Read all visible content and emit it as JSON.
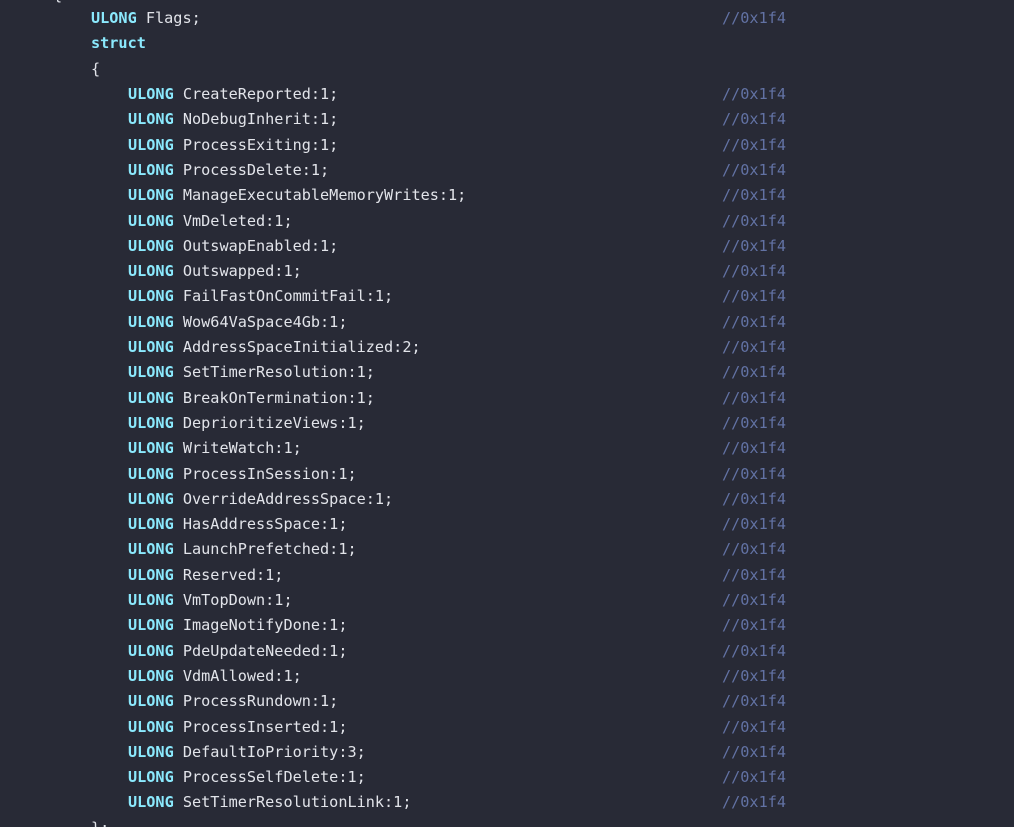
{
  "editor": {
    "top_partial": "{",
    "flags_line": {
      "type": "ULONG",
      "name": "Flags;",
      "comment": "//0x1f4"
    },
    "struct_keyword": "struct",
    "open_brace": "{",
    "close_partial": "};",
    "fields": [
      {
        "type": "ULONG",
        "name": "CreateReported:1;",
        "comment": "//0x1f4"
      },
      {
        "type": "ULONG",
        "name": "NoDebugInherit:1;",
        "comment": "//0x1f4"
      },
      {
        "type": "ULONG",
        "name": "ProcessExiting:1;",
        "comment": "//0x1f4"
      },
      {
        "type": "ULONG",
        "name": "ProcessDelete:1;",
        "comment": "//0x1f4"
      },
      {
        "type": "ULONG",
        "name": "ManageExecutableMemoryWrites:1;",
        "comment": "//0x1f4"
      },
      {
        "type": "ULONG",
        "name": "VmDeleted:1;",
        "comment": "//0x1f4"
      },
      {
        "type": "ULONG",
        "name": "OutswapEnabled:1;",
        "comment": "//0x1f4"
      },
      {
        "type": "ULONG",
        "name": "Outswapped:1;",
        "comment": "//0x1f4"
      },
      {
        "type": "ULONG",
        "name": "FailFastOnCommitFail:1;",
        "comment": "//0x1f4"
      },
      {
        "type": "ULONG",
        "name": "Wow64VaSpace4Gb:1;",
        "comment": "//0x1f4"
      },
      {
        "type": "ULONG",
        "name": "AddressSpaceInitialized:2;",
        "comment": "//0x1f4"
      },
      {
        "type": "ULONG",
        "name": "SetTimerResolution:1;",
        "comment": "//0x1f4"
      },
      {
        "type": "ULONG",
        "name": "BreakOnTermination:1;",
        "comment": "//0x1f4"
      },
      {
        "type": "ULONG",
        "name": "DeprioritizeViews:1;",
        "comment": "//0x1f4"
      },
      {
        "type": "ULONG",
        "name": "WriteWatch:1;",
        "comment": "//0x1f4"
      },
      {
        "type": "ULONG",
        "name": "ProcessInSession:1;",
        "comment": "//0x1f4"
      },
      {
        "type": "ULONG",
        "name": "OverrideAddressSpace:1;",
        "comment": "//0x1f4"
      },
      {
        "type": "ULONG",
        "name": "HasAddressSpace:1;",
        "comment": "//0x1f4"
      },
      {
        "type": "ULONG",
        "name": "LaunchPrefetched:1;",
        "comment": "//0x1f4"
      },
      {
        "type": "ULONG",
        "name": "Reserved:1;",
        "comment": "//0x1f4"
      },
      {
        "type": "ULONG",
        "name": "VmTopDown:1;",
        "comment": "//0x1f4"
      },
      {
        "type": "ULONG",
        "name": "ImageNotifyDone:1;",
        "comment": "//0x1f4"
      },
      {
        "type": "ULONG",
        "name": "PdeUpdateNeeded:1;",
        "comment": "//0x1f4"
      },
      {
        "type": "ULONG",
        "name": "VdmAllowed:1;",
        "comment": "//0x1f4"
      },
      {
        "type": "ULONG",
        "name": "ProcessRundown:1;",
        "comment": "//0x1f4"
      },
      {
        "type": "ULONG",
        "name": "ProcessInserted:1;",
        "comment": "//0x1f4"
      },
      {
        "type": "ULONG",
        "name": "DefaultIoPriority:3;",
        "comment": "//0x1f4"
      },
      {
        "type": "ULONG",
        "name": "ProcessSelfDelete:1;",
        "comment": "//0x1f4"
      },
      {
        "type": "ULONG",
        "name": "SetTimerResolutionLink:1;",
        "comment": "//0x1f4"
      }
    ],
    "colors": {
      "background": "#282a36",
      "keyword": "#8be9fd",
      "identifier": "#e2e4ea",
      "comment": "#6272a4"
    }
  }
}
